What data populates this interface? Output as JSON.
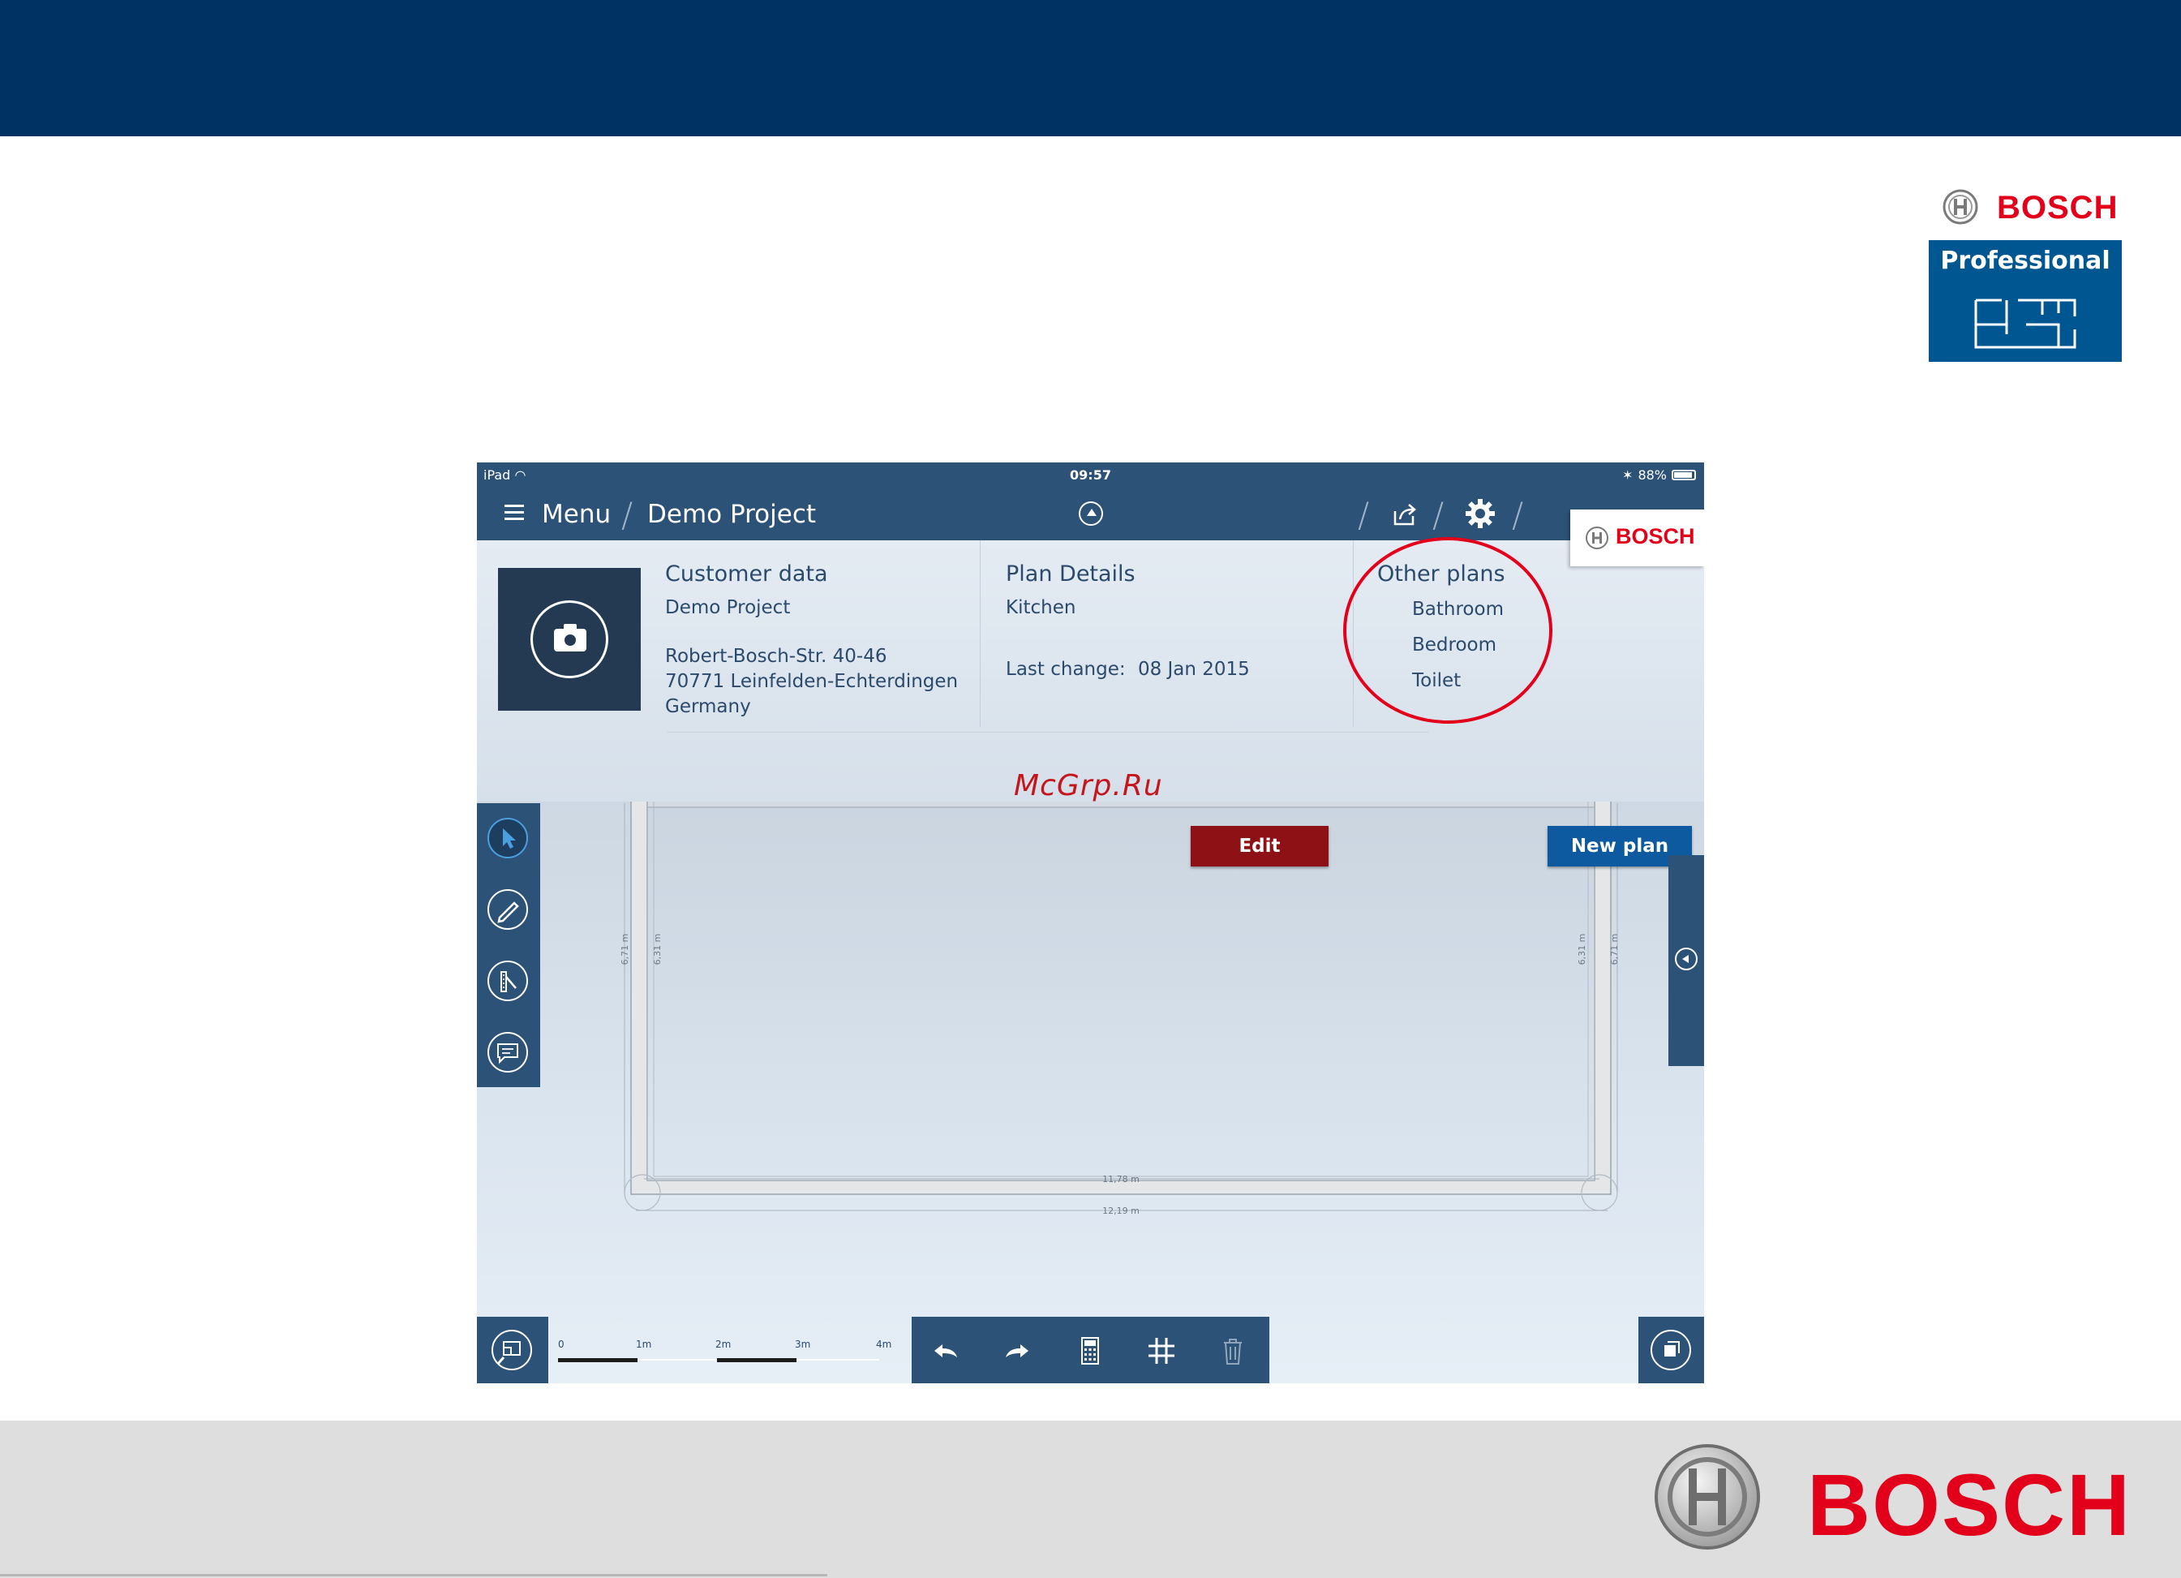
{
  "app": {
    "status_bar": {
      "device": "iPad",
      "time": "09:57",
      "battery": "88%"
    },
    "nav": {
      "menu_label": "Menu",
      "project_label": "Demo Project"
    },
    "brand": "BOSCH",
    "customer": {
      "title": "Customer data",
      "name": "Demo Project",
      "street": "Robert-Bosch-Str. 40-46",
      "city": "70771 Leinfelden-Echterdingen",
      "country": "Germany"
    },
    "plan_details": {
      "title": "Plan Details",
      "name": "Kitchen",
      "last_change_label": "Last change:",
      "last_change_value": "08 Jan 2015"
    },
    "other_plans": {
      "title": "Other plans",
      "items": [
        "Bathroom",
        "Bedroom",
        "Toilet"
      ]
    },
    "buttons": {
      "edit": "Edit",
      "new_plan": "New plan"
    },
    "dimensions": {
      "left_outer": "6,71 m",
      "left_inner": "6,31 m",
      "right_inner": "6,31 m",
      "right_outer": "6,71 m",
      "bottom_inner": "11,78 m",
      "bottom_outer": "12,19 m"
    },
    "scale": {
      "labels": [
        "0",
        "1m",
        "2m",
        "3m",
        "4m"
      ]
    },
    "icons": {
      "left_toolbar": [
        "pointer-icon",
        "pencil-icon",
        "ruler-icon",
        "comment-icon"
      ],
      "bottom_toolbar": [
        "undo-icon",
        "redo-icon",
        "calculator-icon",
        "grid-icon",
        "trash-icon"
      ]
    }
  },
  "slide": {
    "brand_top": "BOSCH",
    "professional": "Professional",
    "brand_bottom": "BOSCH",
    "watermark": "McGrp.Ru",
    "colors": {
      "banner": "#003263",
      "brand_red": "#e2001a",
      "app_blue": "#2c5277",
      "edit_red": "#8e1115",
      "new_plan_blue": "#0d5aa0"
    }
  }
}
